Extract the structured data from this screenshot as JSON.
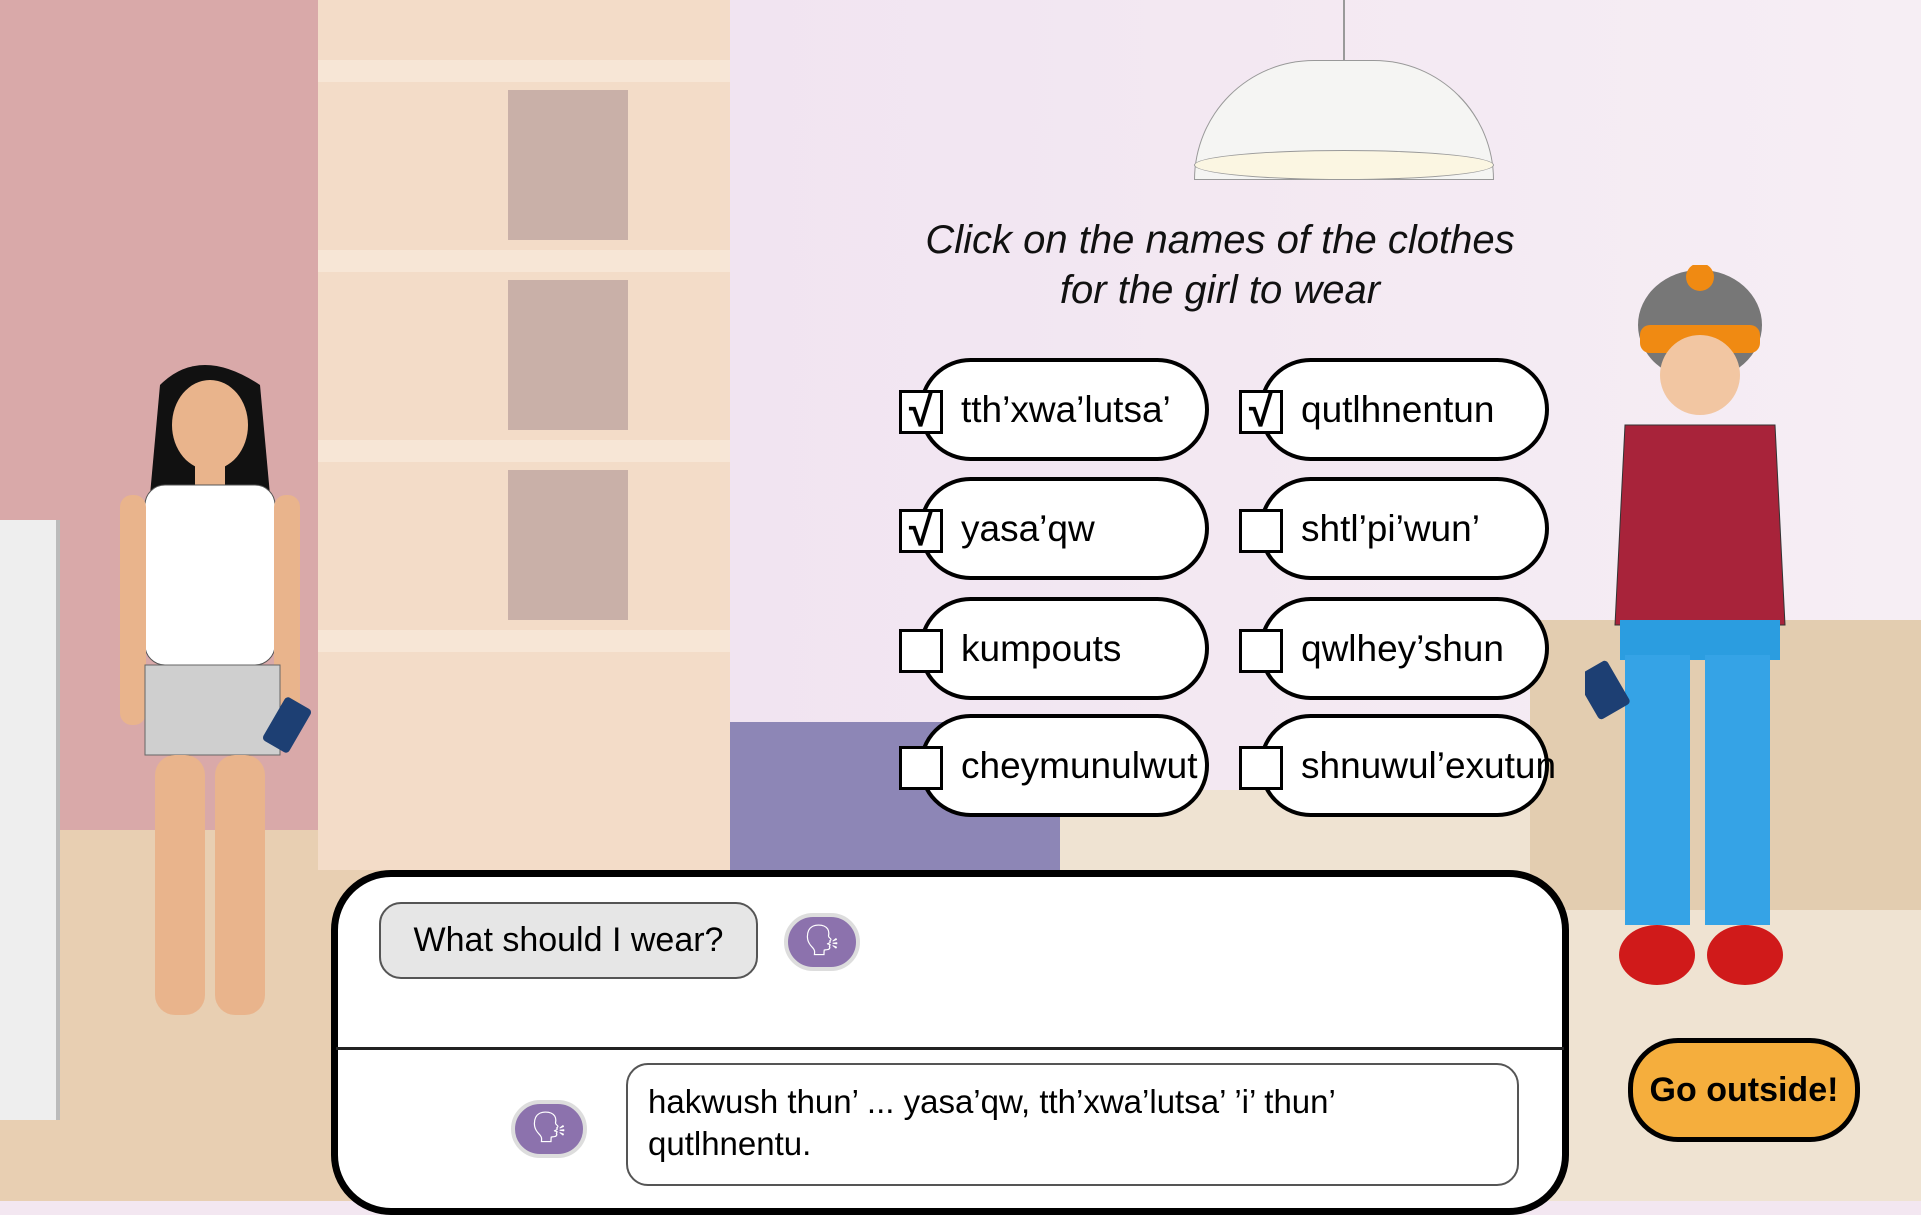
{
  "instruction": {
    "line1": "Click on the names of the clothes",
    "line2": "for the girl to wear"
  },
  "clothes": [
    {
      "label": "tth’xwa’lutsa’",
      "checked": true,
      "mark": "√"
    },
    {
      "label": "qutlhnentun",
      "checked": true,
      "mark": "√"
    },
    {
      "label": "yasa’qw",
      "checked": true,
      "mark": "√"
    },
    {
      "label": "shtl’pi’wun’",
      "checked": false,
      "mark": ""
    },
    {
      "label": "kumpouts",
      "checked": false,
      "mark": ""
    },
    {
      "label": "qwlhey’shun",
      "checked": false,
      "mark": ""
    },
    {
      "label": "cheymunulwut",
      "checked": false,
      "mark": ""
    },
    {
      "label": "shnuwul’exutun",
      "checked": false,
      "mark": ""
    }
  ],
  "dialog": {
    "question": "What should I wear?",
    "answer": "hakwush thun’ ... yasa’qw, tth’xwa’lutsa’ ’i’ thun’ qutlhnentu."
  },
  "go_outside_label": "Go outside!",
  "colors": {
    "audio": "#8c72ad",
    "go_button": "#f5ae3d",
    "wall": "#f1e4f1"
  }
}
